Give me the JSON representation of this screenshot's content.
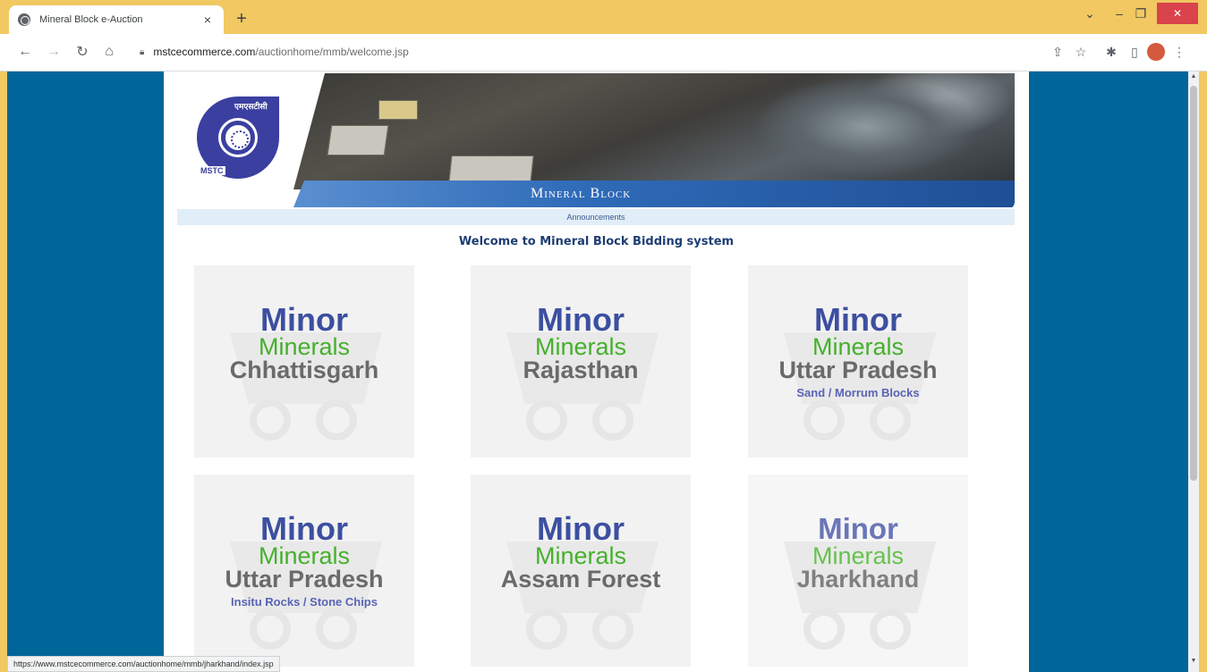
{
  "browser": {
    "tab_title": "Mineral Block e-Auction",
    "tab_close": "×",
    "new_tab": "+",
    "url_host": "mstcecommerce.com",
    "url_path": "/auctionhome/mmb/welcome.jsp",
    "status_url": "https://www.mstcecommerce.com/auctionhome/mmb/jharkhand/index.jsp"
  },
  "banner": {
    "title": "Mineral Block",
    "logo_text": "MSTC",
    "logo_hindi": "एमएसटीसी",
    "announcements": "Announcements"
  },
  "welcome": "Welcome to Mineral Block Bidding system",
  "tiles": [
    {
      "minor": "Minor",
      "minerals": "Minerals",
      "state": "Chhattisgarh",
      "sub": ""
    },
    {
      "minor": "Minor",
      "minerals": "Minerals",
      "state": "Rajasthan",
      "sub": ""
    },
    {
      "minor": "Minor",
      "minerals": "Minerals",
      "state": "Uttar Pradesh",
      "sub": "Sand / Morrum Blocks"
    },
    {
      "minor": "Minor",
      "minerals": "Minerals",
      "state": "Uttar Pradesh",
      "sub": "Insitu Rocks / Stone Chips"
    },
    {
      "minor": "Minor",
      "minerals": "Minerals",
      "state": "Assam Forest",
      "sub": ""
    },
    {
      "minor": "Minor",
      "minerals": "Minerals",
      "state": "Jharkhand",
      "sub": ""
    }
  ],
  "colors": {
    "page_bg": "#006699",
    "tab_strip": "#f1c862",
    "minor_text": "#3c4fa0",
    "minerals_text": "#45b02c"
  }
}
